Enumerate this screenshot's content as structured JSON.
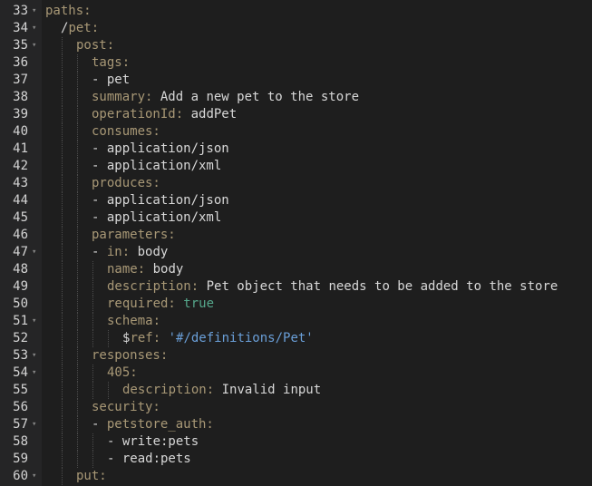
{
  "editor": {
    "lines": [
      {
        "num": "33",
        "fold": true,
        "indent": 0,
        "tokens": [
          {
            "t": "paths:",
            "c": "k"
          }
        ]
      },
      {
        "num": "34",
        "fold": true,
        "indent": 1,
        "tokens": [
          {
            "t": "/",
            "c": "t"
          },
          {
            "t": "pet:",
            "c": "k"
          }
        ]
      },
      {
        "num": "35",
        "fold": true,
        "indent": 2,
        "tokens": [
          {
            "t": "post:",
            "c": "k"
          }
        ]
      },
      {
        "num": "36",
        "fold": false,
        "indent": 3,
        "tokens": [
          {
            "t": "tags:",
            "c": "k"
          }
        ]
      },
      {
        "num": "37",
        "fold": false,
        "indent": 3,
        "tokens": [
          {
            "t": "- pet",
            "c": "t"
          }
        ]
      },
      {
        "num": "38",
        "fold": false,
        "indent": 3,
        "tokens": [
          {
            "t": "summary:",
            "c": "k"
          },
          {
            "t": " Add a new pet to the store",
            "c": "t"
          }
        ]
      },
      {
        "num": "39",
        "fold": false,
        "indent": 3,
        "tokens": [
          {
            "t": "operationId:",
            "c": "k"
          },
          {
            "t": " addPet",
            "c": "t"
          }
        ]
      },
      {
        "num": "40",
        "fold": false,
        "indent": 3,
        "tokens": [
          {
            "t": "consumes:",
            "c": "k"
          }
        ]
      },
      {
        "num": "41",
        "fold": false,
        "indent": 3,
        "tokens": [
          {
            "t": "- application/json",
            "c": "t"
          }
        ]
      },
      {
        "num": "42",
        "fold": false,
        "indent": 3,
        "tokens": [
          {
            "t": "- application/xml",
            "c": "t"
          }
        ]
      },
      {
        "num": "43",
        "fold": false,
        "indent": 3,
        "tokens": [
          {
            "t": "produces:",
            "c": "k"
          }
        ]
      },
      {
        "num": "44",
        "fold": false,
        "indent": 3,
        "tokens": [
          {
            "t": "- application/json",
            "c": "t"
          }
        ]
      },
      {
        "num": "45",
        "fold": false,
        "indent": 3,
        "tokens": [
          {
            "t": "- application/xml",
            "c": "t"
          }
        ]
      },
      {
        "num": "46",
        "fold": false,
        "indent": 3,
        "tokens": [
          {
            "t": "parameters:",
            "c": "k"
          }
        ]
      },
      {
        "num": "47",
        "fold": true,
        "indent": 3,
        "tokens": [
          {
            "t": "- ",
            "c": "t"
          },
          {
            "t": "in:",
            "c": "k"
          },
          {
            "t": " body",
            "c": "t"
          }
        ]
      },
      {
        "num": "48",
        "fold": false,
        "indent": 4,
        "tokens": [
          {
            "t": "name:",
            "c": "k"
          },
          {
            "t": " body",
            "c": "t"
          }
        ]
      },
      {
        "num": "49",
        "fold": false,
        "indent": 4,
        "tokens": [
          {
            "t": "description:",
            "c": "k"
          },
          {
            "t": " Pet object that needs to be added to the store",
            "c": "t"
          }
        ]
      },
      {
        "num": "50",
        "fold": false,
        "indent": 4,
        "tokens": [
          {
            "t": "required:",
            "c": "k"
          },
          {
            "t": " true",
            "c": "b"
          }
        ]
      },
      {
        "num": "51",
        "fold": true,
        "indent": 4,
        "tokens": [
          {
            "t": "schema:",
            "c": "k"
          }
        ]
      },
      {
        "num": "52",
        "fold": false,
        "indent": 5,
        "tokens": [
          {
            "t": "$",
            "c": "t"
          },
          {
            "t": "ref:",
            "c": "k"
          },
          {
            "t": " '#/definitions/Pet'",
            "c": "s"
          }
        ]
      },
      {
        "num": "53",
        "fold": true,
        "indent": 3,
        "tokens": [
          {
            "t": "responses:",
            "c": "k"
          }
        ]
      },
      {
        "num": "54",
        "fold": true,
        "indent": 4,
        "tokens": [
          {
            "t": "405:",
            "c": "k"
          }
        ]
      },
      {
        "num": "55",
        "fold": false,
        "indent": 5,
        "tokens": [
          {
            "t": "description:",
            "c": "k"
          },
          {
            "t": " Invalid input",
            "c": "t"
          }
        ]
      },
      {
        "num": "56",
        "fold": false,
        "indent": 3,
        "tokens": [
          {
            "t": "security:",
            "c": "k"
          }
        ]
      },
      {
        "num": "57",
        "fold": true,
        "indent": 3,
        "tokens": [
          {
            "t": "- ",
            "c": "t"
          },
          {
            "t": "petstore_auth:",
            "c": "k"
          }
        ]
      },
      {
        "num": "58",
        "fold": false,
        "indent": 4,
        "tokens": [
          {
            "t": "- write:pets",
            "c": "t"
          }
        ]
      },
      {
        "num": "59",
        "fold": false,
        "indent": 4,
        "tokens": [
          {
            "t": "- read:pets",
            "c": "t"
          }
        ]
      },
      {
        "num": "60",
        "fold": true,
        "indent": 2,
        "tokens": [
          {
            "t": "put:",
            "c": "k"
          }
        ]
      }
    ],
    "fold_glyph": "▾"
  }
}
